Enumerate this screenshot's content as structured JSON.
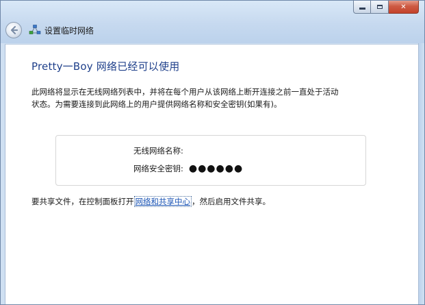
{
  "window": {
    "caption": {
      "minimize_glyph": "minimize-icon",
      "maximize_glyph": "maximize-icon",
      "close_symbol": "✕"
    }
  },
  "header": {
    "title": "设置临时网络",
    "back_icon": "back-arrow-icon",
    "network_icon": "adhoc-network-icon"
  },
  "main": {
    "heading": "Pretty一Boy 网络已经可以使用",
    "description_line1": "此网络将显示在无线网络列表中，并将在每个用户从该网络上断开连接之前一直处于活动",
    "description_line2": "状态。为需要连接到此网络上的用户提供网络名称和安全密钥(如果有)。",
    "info": {
      "network_name_label": "无线网络名称:",
      "network_name_value": "",
      "security_key_label": "网络安全密钥:",
      "security_key_value": "●●●●●●"
    },
    "sharing": {
      "prefix": "要共享文件，在控制面板打开",
      "link": "网络和共享中心",
      "suffix": "，然后启用文件共享。"
    }
  },
  "colors": {
    "heading_blue": "#1e3f8a",
    "link_blue": "#1c55b5",
    "close_red": "#c4422b"
  }
}
